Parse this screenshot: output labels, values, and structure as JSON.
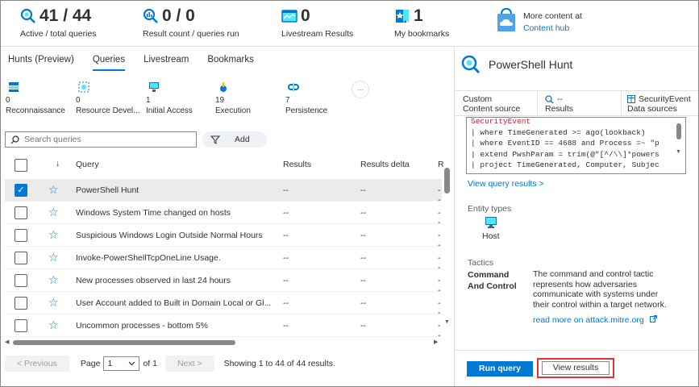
{
  "stats": [
    {
      "value": "41 / 44",
      "label": "Active / total queries",
      "icon": "query-icon"
    },
    {
      "value": "0 / 0",
      "label": "Result count / queries run",
      "icon": "results-icon"
    },
    {
      "value": "0",
      "label": "Livestream Results",
      "icon": "livestream-icon"
    },
    {
      "value": "1",
      "label": "My bookmarks",
      "icon": "bookmark-icon"
    }
  ],
  "content_hub": {
    "title": "More content at",
    "link": "Content hub"
  },
  "tabs": [
    {
      "label": "Hunts (Preview)",
      "active": false
    },
    {
      "label": "Queries",
      "active": true
    },
    {
      "label": "Livestream",
      "active": false
    },
    {
      "label": "Bookmarks",
      "active": false
    }
  ],
  "tactics": [
    {
      "count": "0",
      "name": "Reconnaissance"
    },
    {
      "count": "0",
      "name": "Resource Devel..."
    },
    {
      "count": "1",
      "name": "Initial Access"
    },
    {
      "count": "19",
      "name": "Execution"
    },
    {
      "count": "7",
      "name": "Persistence"
    }
  ],
  "more_label": "...",
  "search": {
    "placeholder": "Search queries"
  },
  "add_label": "Add",
  "columns": {
    "query": "Query",
    "results": "Results",
    "delta": "Results delta",
    "r2": "R"
  },
  "rows": [
    {
      "query": "PowerShell Hunt",
      "results": "--",
      "delta": "--",
      "r2": "--",
      "selected": true
    },
    {
      "query": "Windows System Time changed on hosts",
      "results": "--",
      "delta": "--",
      "r2": "--",
      "selected": false
    },
    {
      "query": "Suspicious Windows Login Outside Normal Hours",
      "results": "--",
      "delta": "--",
      "r2": "--",
      "selected": false
    },
    {
      "query": "Invoke-PowerShellTcpOneLine Usage.",
      "results": "--",
      "delta": "--",
      "r2": "--",
      "selected": false
    },
    {
      "query": "New processes observed in last 24 hours",
      "results": "--",
      "delta": "--",
      "r2": "--",
      "selected": false
    },
    {
      "query": "User Account added to Built in Domain Local or Gl...",
      "results": "--",
      "delta": "--",
      "r2": "--",
      "selected": false
    },
    {
      "query": "Uncommon processes - bottom 5%",
      "results": "--",
      "delta": "--",
      "r2": "--",
      "selected": false
    }
  ],
  "pager": {
    "previous": "< Previous",
    "page_label": "Page",
    "page_value": "1",
    "of_label": "of 1",
    "next": "Next >",
    "summary": "Showing 1 to 44 of 44 results."
  },
  "detail": {
    "title": "PowerShell Hunt",
    "source_label": "Custom",
    "source_sub": "Content source",
    "results_value": "--",
    "results_sub": "Results",
    "datasource_value": "SecurityEvent",
    "datasource_sub": "Data sources",
    "code": [
      "SecurityEvent",
      "| where TimeGenerated >= ago(lookback)",
      "| where EventID == 4688 and Process =~ \"p",
      "| extend PwshParam = trim(@\"[^/\\\\]*powers",
      "| project TimeGenerated, Computer, Subjec"
    ],
    "view_query_results": "View query results >",
    "entity_types_label": "Entity types",
    "entity": "Host",
    "tactics_label": "Tactics",
    "tactic_name": "Command And Control",
    "tactic_desc": "The command and control tactic represents how adversaries communicate with systems under their control within a target network.",
    "tactic_link": "read more on attack.mitre.org",
    "run_query": "Run query",
    "view_results": "View results"
  },
  "colors": {
    "accent": "#0078d4",
    "highlight": "#e3342f"
  }
}
